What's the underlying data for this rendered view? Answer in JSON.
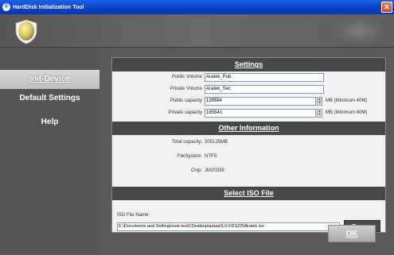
{
  "window": {
    "title": "HardDisk Initialization Tool"
  },
  "sidebar": {
    "items": [
      {
        "label": "Init-Device"
      },
      {
        "label": "Default Settings"
      },
      {
        "label": "Help"
      }
    ]
  },
  "settings": {
    "header": "Settings",
    "public_volume": {
      "label": "Public Volume",
      "value": "Aratek_Pub"
    },
    "private_volume": {
      "label": "Private Volume",
      "value": "Aratek_Sec"
    },
    "public_capacity": {
      "label": "Public capacity",
      "value": "139584",
      "unit": "MB  (Minimum 40M)"
    },
    "private_capacity": {
      "label": "Private capacity",
      "value": "165541",
      "unit": "MB  (Minimum 40M)"
    }
  },
  "other": {
    "header": "Other Information",
    "total": {
      "label": "Total capacity:",
      "value": "305125MB"
    },
    "fs": {
      "label": "FileSystem:",
      "value": "NTFS"
    },
    "chip": {
      "label": "Chip:",
      "value": "JM20339"
    }
  },
  "iso": {
    "header": "Select ISO File",
    "label": "ISO File Name:",
    "path": "E:\\Documents and Settings\\ssk-test1\\Desktop\\aa\\aa\\5.0-FDS225Aratek.iso",
    "browse_label": "Browse"
  },
  "actions": {
    "ok_label": "OK"
  }
}
